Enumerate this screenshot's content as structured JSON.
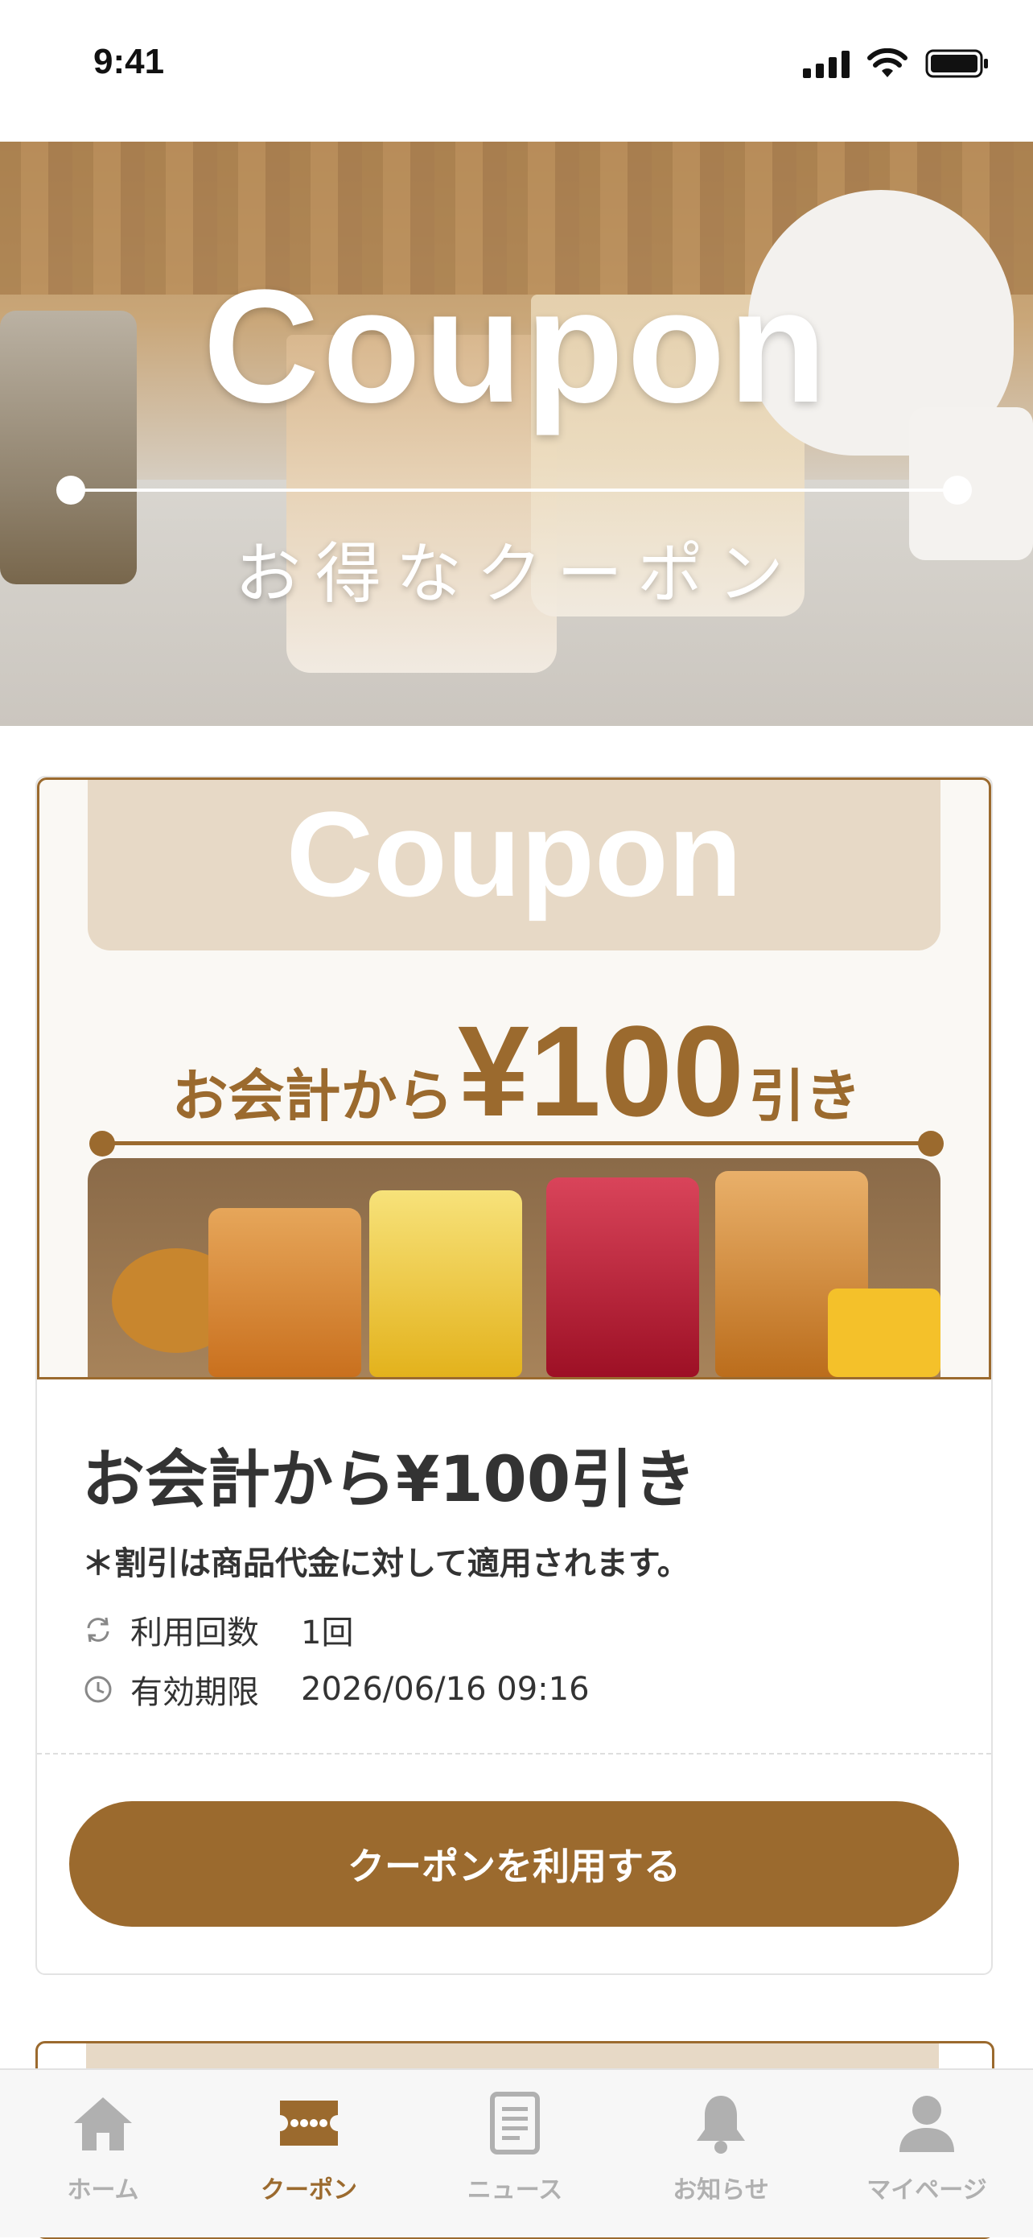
{
  "status_bar": {
    "time": "9:41"
  },
  "hero": {
    "title": "Coupon",
    "subtitle": "お得なクーポン"
  },
  "coupon": {
    "banner_title": "Coupon",
    "banner_prefix": "お会計から",
    "banner_amount": "¥100",
    "banner_suffix": "引き",
    "title": "お会計から¥100引き",
    "note": "＊割引は商品代金に対して適用されます。",
    "usage_label": "利用回数",
    "usage_value": "1回",
    "expiry_label": "有効期限",
    "expiry_value": "2026/06/16 09:16",
    "button_label": "クーポンを利用する"
  },
  "tabbar": {
    "items": [
      {
        "label": "ホーム",
        "icon": "home-icon"
      },
      {
        "label": "クーポン",
        "icon": "ticket-icon",
        "active": true
      },
      {
        "label": "ニュース",
        "icon": "news-icon"
      },
      {
        "label": "お知らせ",
        "icon": "bell-icon"
      },
      {
        "label": "マイページ",
        "icon": "person-icon"
      }
    ]
  },
  "colors": {
    "accent": "#9b6a2e",
    "inactive": "#b0b0b0",
    "tab_bg": "#e7d9c6"
  }
}
